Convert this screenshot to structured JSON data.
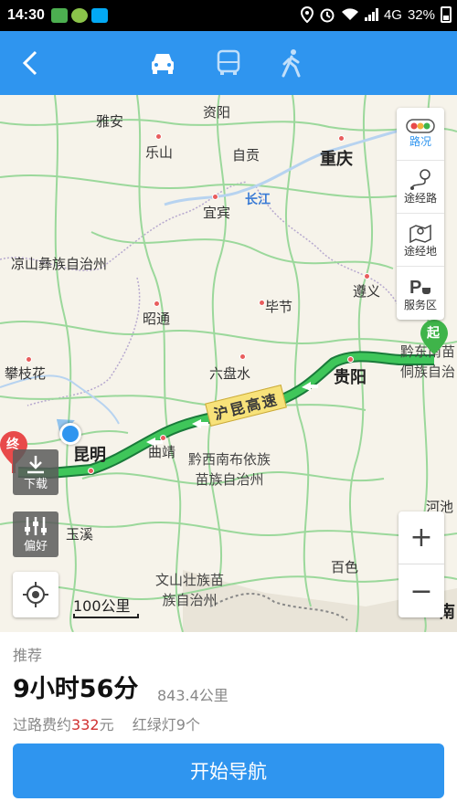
{
  "status_bar": {
    "time": "14:30",
    "network": "4G",
    "battery": "32%",
    "icons": [
      "wechat-icon",
      "app-icon",
      "app-icon",
      "location-icon",
      "alarm-icon",
      "wifi-icon",
      "signal-icon",
      "battery-icon"
    ]
  },
  "nav": {
    "back_icon": "back-arrow-icon",
    "modes": [
      "car-icon",
      "bus-icon",
      "walk-icon"
    ],
    "active_mode": "car"
  },
  "map": {
    "cities": [
      {
        "name": "雅安",
        "type": "normal"
      },
      {
        "name": "资阳",
        "type": "normal"
      },
      {
        "name": "乐山",
        "type": "normal"
      },
      {
        "name": "自贡",
        "type": "normal"
      },
      {
        "name": "重庆",
        "type": "big"
      },
      {
        "name": "宜宾",
        "type": "normal"
      },
      {
        "name": "凉山彝族自治州",
        "type": "normal"
      },
      {
        "name": "昭通",
        "type": "normal"
      },
      {
        "name": "毕节",
        "type": "normal"
      },
      {
        "name": "遵义",
        "type": "normal"
      },
      {
        "name": "攀枝花",
        "type": "normal"
      },
      {
        "name": "六盘水",
        "type": "normal"
      },
      {
        "name": "贵阳",
        "type": "big"
      },
      {
        "name": "昆明",
        "type": "big"
      },
      {
        "name": "曲靖",
        "type": "normal"
      },
      {
        "name": "玉溪",
        "type": "normal"
      },
      {
        "name": "百色",
        "type": "normal"
      },
      {
        "name": "河池",
        "type": "normal"
      },
      {
        "name": "南",
        "type": "normal"
      }
    ],
    "regions": {
      "qiannan": [
        "黔西南布依族",
        "苗族自治州"
      ],
      "wenshan": [
        "文山壮族苗",
        "族自治州"
      ],
      "qiandongnan": [
        "黔东南苗",
        "侗族自治"
      ]
    },
    "river": "长江",
    "highway_label": "沪昆高速",
    "start_marker": "起",
    "end_marker": "终",
    "scale_label": "100公里",
    "route_color": "#3fc65a",
    "accent_color": "#2f95ef"
  },
  "side_panel": {
    "traffic": "路况",
    "via_route": "途经路",
    "via_place": "途经地",
    "service_area": "服务区"
  },
  "map_buttons": {
    "download": "下载",
    "preference": "偏好",
    "zoom_in": "+",
    "zoom_out": "−"
  },
  "summary": {
    "recommend": "推荐",
    "duration": "9小时56分",
    "distance": "843.4公里",
    "toll_prefix": "过路费约",
    "toll_amount": "332",
    "toll_suffix": "元",
    "traffic_lights": "红绿灯9个",
    "start_button": "开始导航"
  }
}
